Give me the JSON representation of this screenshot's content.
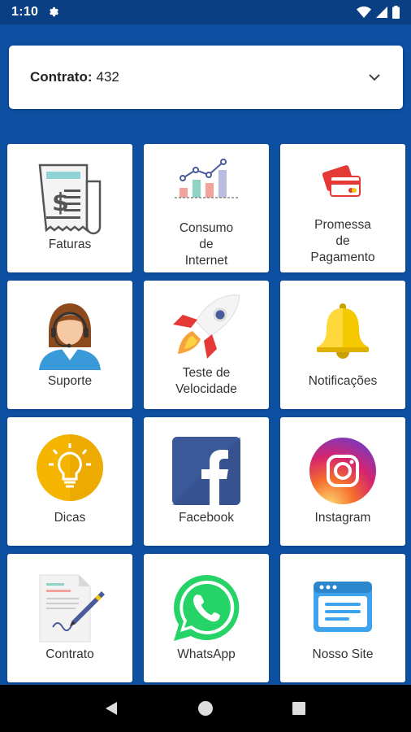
{
  "status": {
    "time": "1:10"
  },
  "selector": {
    "label": "Contrato:",
    "value": "432"
  },
  "tiles": [
    {
      "label": "Faturas",
      "icon": "invoice-icon"
    },
    {
      "label": "Consumo\nde\nInternet",
      "icon": "bar-chart-icon"
    },
    {
      "label": "Promessa\nde\nPagamento",
      "icon": "credit-card-icon"
    },
    {
      "label": "Suporte",
      "icon": "support-agent-icon"
    },
    {
      "label": "Teste de\nVelocidade",
      "icon": "rocket-icon"
    },
    {
      "label": "Notificações",
      "icon": "bell-icon"
    },
    {
      "label": "Dicas",
      "icon": "lightbulb-icon"
    },
    {
      "label": "Facebook",
      "icon": "facebook-icon"
    },
    {
      "label": "Instagram",
      "icon": "instagram-icon"
    },
    {
      "label": "Contrato",
      "icon": "contract-icon"
    },
    {
      "label": "WhatsApp",
      "icon": "whatsapp-icon"
    },
    {
      "label": "Nosso Site",
      "icon": "website-icon"
    }
  ],
  "colors": {
    "background": "#0d4fa0",
    "statusbar": "#0a3f83",
    "facebook": "#3b5998",
    "whatsapp": "#25d366",
    "bell": "#f5c800"
  }
}
